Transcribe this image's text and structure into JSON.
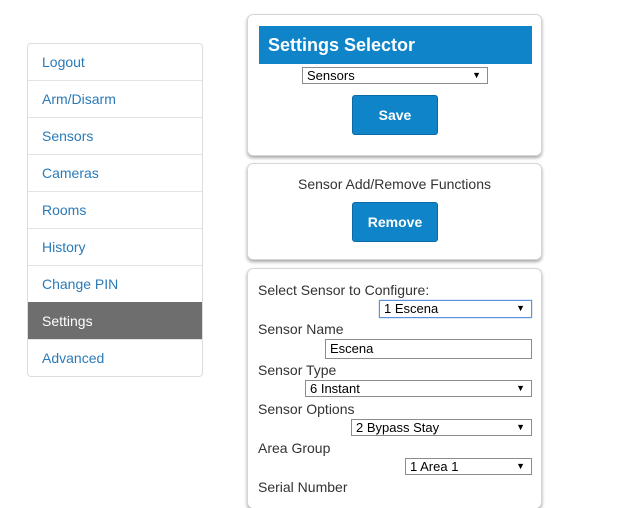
{
  "sidebar": {
    "items": [
      {
        "label": "Logout"
      },
      {
        "label": "Arm/Disarm"
      },
      {
        "label": "Sensors"
      },
      {
        "label": "Cameras"
      },
      {
        "label": "Rooms"
      },
      {
        "label": "History"
      },
      {
        "label": "Change PIN"
      },
      {
        "label": "Settings",
        "active": true
      },
      {
        "label": "Advanced"
      }
    ]
  },
  "settings_selector": {
    "title": "Settings Selector",
    "selected": "Sensors",
    "save_label": "Save"
  },
  "sensor_functions": {
    "title": "Sensor Add/Remove Functions",
    "remove_label": "Remove"
  },
  "sensor_config": {
    "select_label": "Select Sensor to Configure:",
    "selected_sensor": "1 Escena",
    "name_label": "Sensor Name",
    "name_value": "Escena",
    "type_label": "Sensor Type",
    "type_value": "6 Instant",
    "options_label": "Sensor Options",
    "options_value": "2 Bypass Stay",
    "area_label": "Area Group",
    "area_value": "1 Area 1",
    "serial_label": "Serial Number"
  },
  "colors": {
    "accent": "#0f84c9",
    "active_nav": "#6e6e6e",
    "link": "#2a7ab8"
  }
}
